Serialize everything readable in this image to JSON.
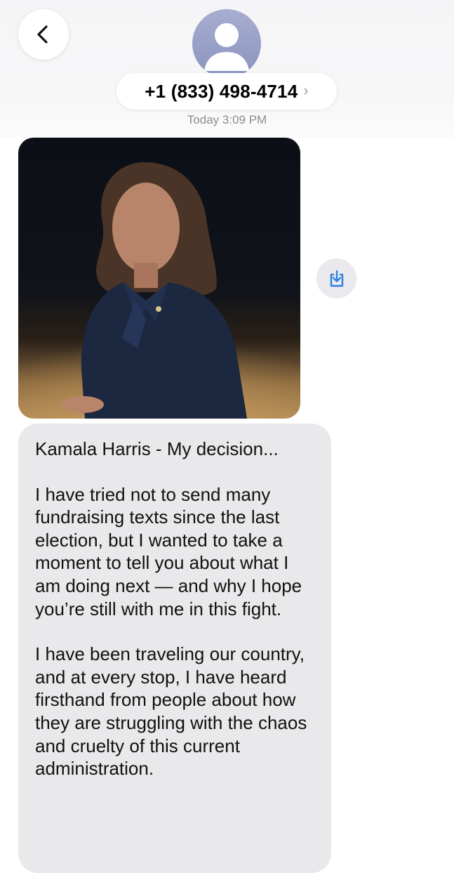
{
  "header": {
    "back_icon": "chevron-left-icon",
    "avatar_icon": "person-icon",
    "contact_number": "+1 (833) 498-4714",
    "contact_chevron": "›",
    "timestamp_day": "Today",
    "timestamp_time": "3:09 PM"
  },
  "attachment": {
    "type": "photo",
    "save_icon": "download-to-device-icon"
  },
  "message": {
    "title": "Kamala Harris - My decision...",
    "paragraph_1": "I have tried not to send many fundraising texts since the last election, but I wanted to take a moment to tell you about what I am doing next — and why I hope you’re still with me in this fight.",
    "paragraph_2": "I have been traveling our country, and at every stop, I have heard firsthand from people about how they are struggling with the chaos and cruelty of this current administration."
  },
  "colors": {
    "bubble_gray": "#e9e9eb",
    "accent_blue": "#2f7fe0",
    "secondary_text": "#8e8e93"
  }
}
